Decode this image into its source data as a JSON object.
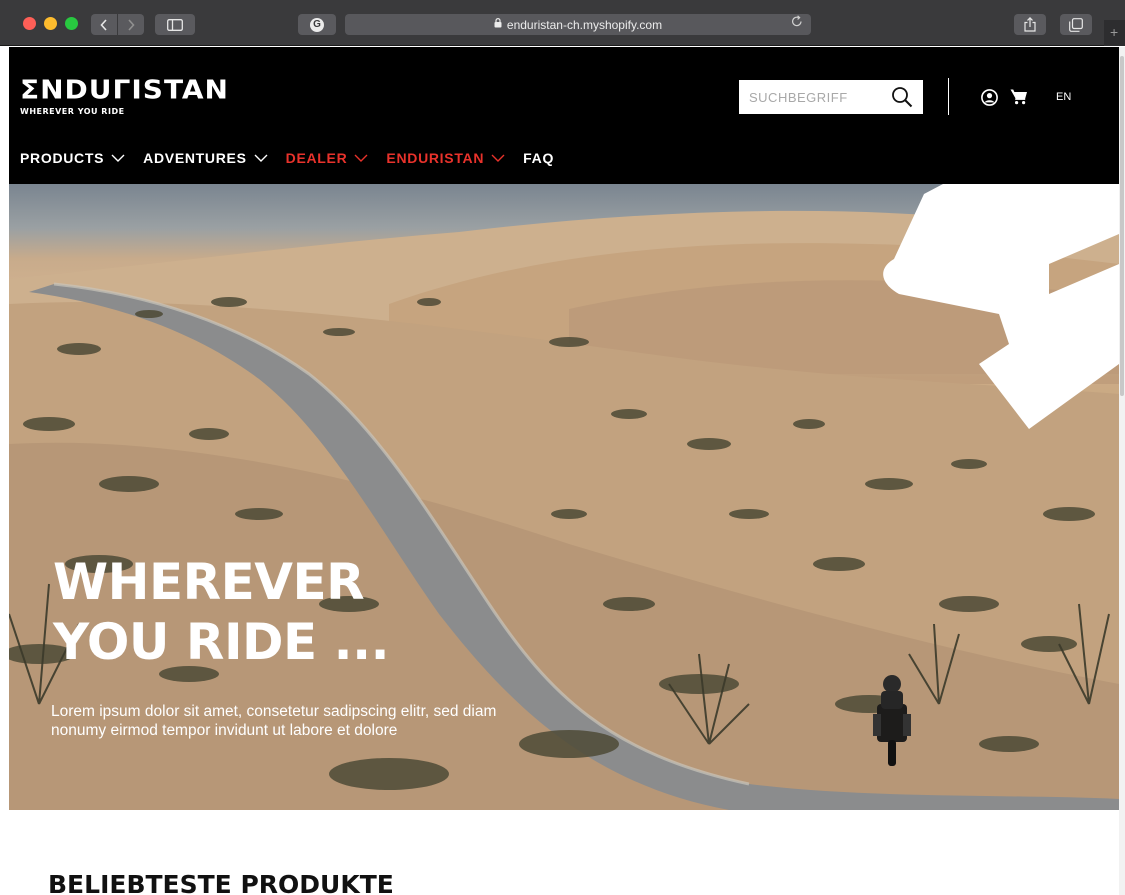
{
  "browser": {
    "url": "enduristan-ch.myshopify.com",
    "extension_glyph": "G",
    "plus_glyph": "+"
  },
  "header": {
    "logo": "ΣNDUΓISTAN",
    "tagline": "WHEREVER YOU RIDE",
    "search_placeholder": "SUCHBEGRIFF",
    "language": "EN"
  },
  "nav": {
    "items": [
      {
        "label": "PRODUCTS",
        "color": "#ffffff",
        "has_dropdown": true
      },
      {
        "label": "ADVENTURES",
        "color": "#ffffff",
        "has_dropdown": true
      },
      {
        "label": "DEALER",
        "color": "#e8322b",
        "has_dropdown": true
      },
      {
        "label": "ENDURISTAN",
        "color": "#e8322b",
        "has_dropdown": true
      },
      {
        "label": "FAQ",
        "color": "#ffffff",
        "has_dropdown": false
      }
    ]
  },
  "hero": {
    "title_line1": "WHEREVER",
    "title_line2": "YOU RIDE ...",
    "text": "Lorem ipsum dolor sit amet, consetetur sadipscing elitr, sed diam nonumy eirmod tempor invidunt ut labore et dolore"
  },
  "section": {
    "title": "BELIEBTESTE PRODUKTE"
  },
  "colors": {
    "accent_red": "#e8322b",
    "header_bg": "#000000"
  }
}
